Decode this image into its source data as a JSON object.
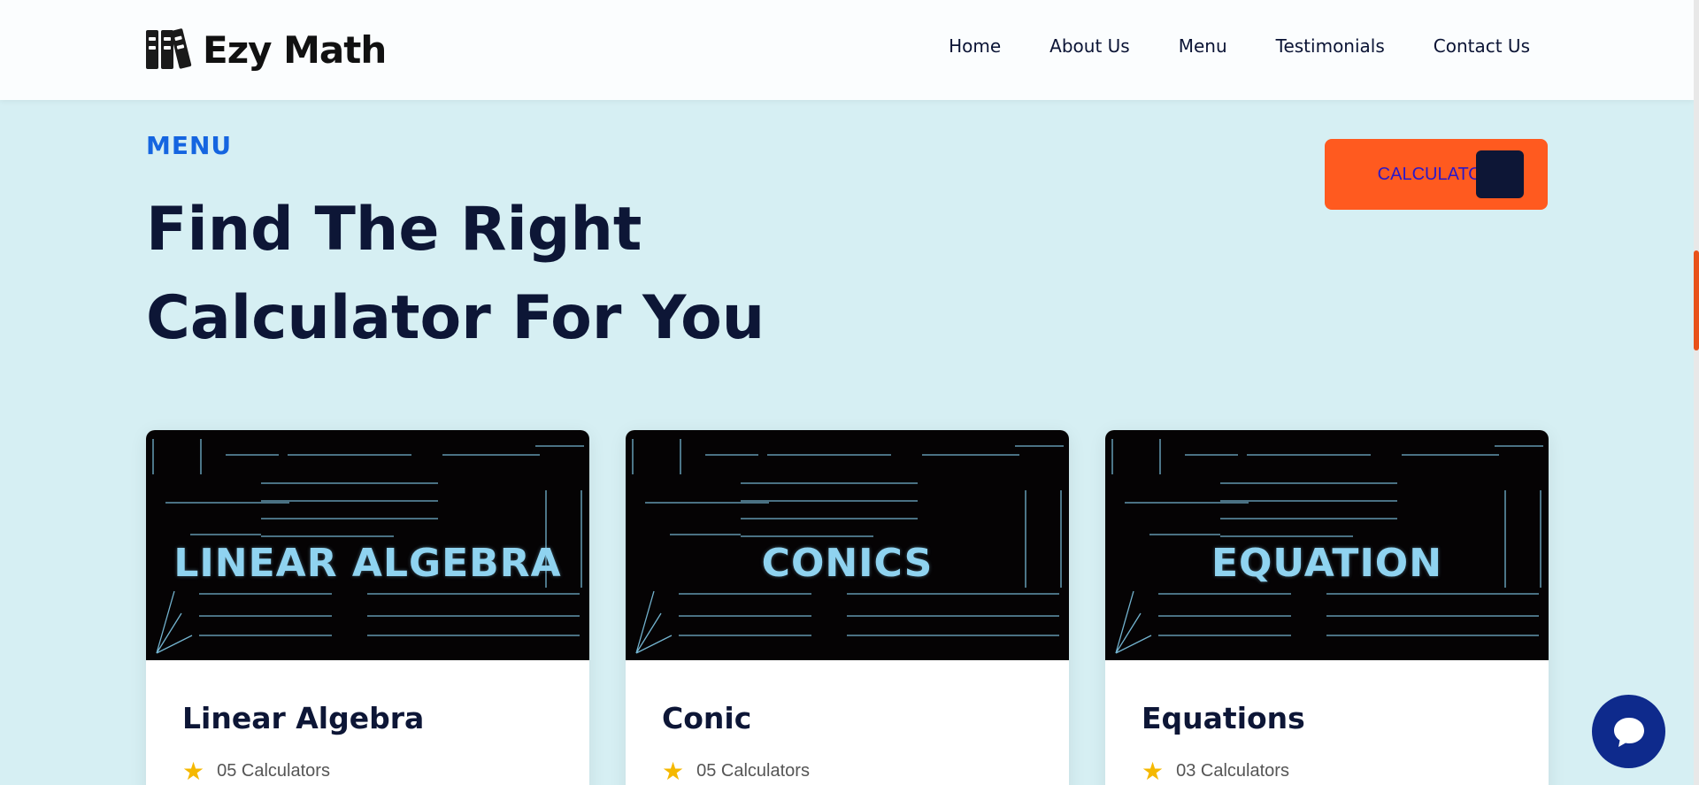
{
  "header": {
    "logo_text": "Ezy Math",
    "nav": [
      "Home",
      "About Us",
      "Menu",
      "Testimonials",
      "Contact Us"
    ]
  },
  "section": {
    "kicker": "MENU",
    "title_line1": "Find The Right",
    "title_line2": "Calculator For You",
    "button_label": "CALCULATOR"
  },
  "cards": [
    {
      "image_label": "LINEAR ALGEBRA",
      "title": "Linear Algebra",
      "count": "05 Calculators"
    },
    {
      "image_label": "CONICS",
      "title": "Conic",
      "count": "05 Calculators"
    },
    {
      "image_label": "EQUATION",
      "title": "Equations",
      "count": "03 Calculators"
    }
  ],
  "colors": {
    "background": "#d6eff3",
    "accent_blue": "#1565e0",
    "accent_orange": "#ff5a1f",
    "navy": "#0d1636",
    "star": "#f5b800"
  },
  "icons": [
    "logo-books-icon",
    "star-icon",
    "chat-icon"
  ]
}
